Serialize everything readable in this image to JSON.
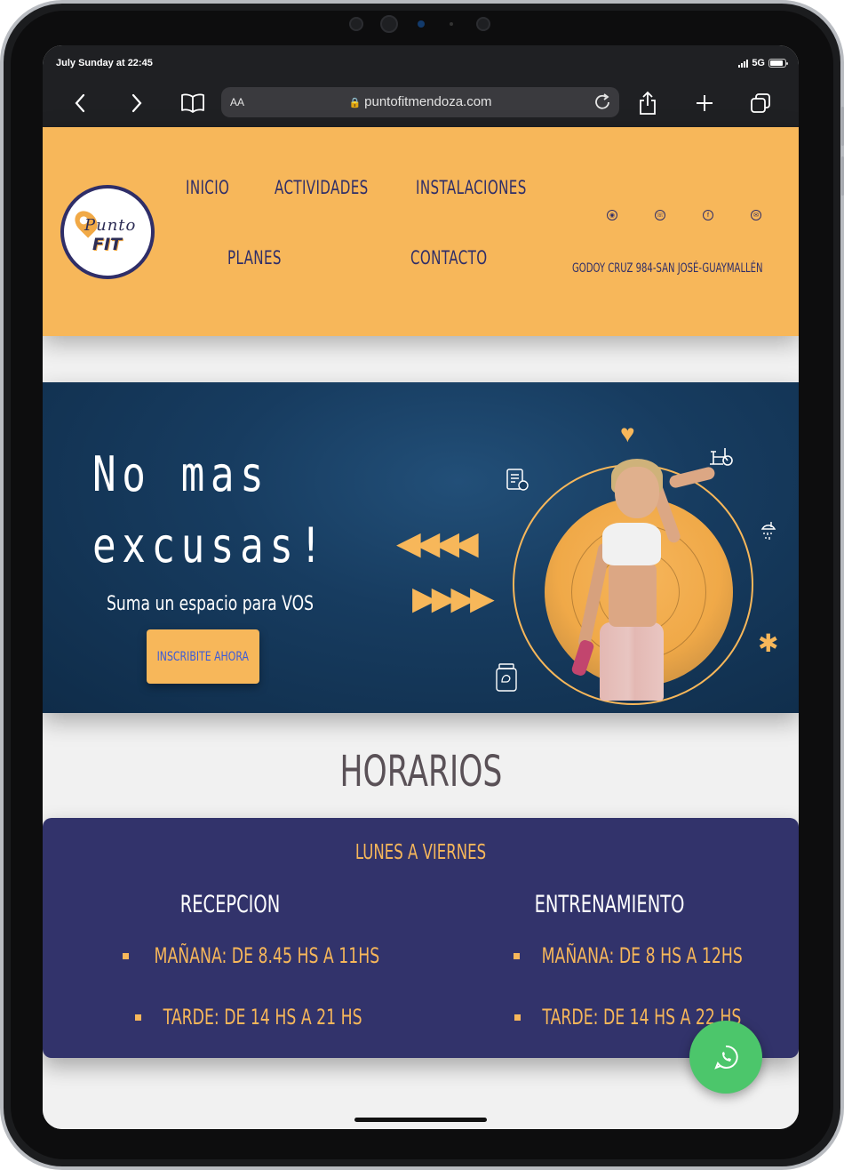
{
  "status_bar": {
    "time": "July Sunday at 22:45",
    "network": "5G"
  },
  "browser": {
    "reader_label": "AA",
    "url": "puntofitmendoza.com",
    "icons": [
      "chevron-left-icon",
      "chevron-right-icon",
      "book-icon",
      "lock-icon",
      "reload-icon",
      "share-icon",
      "plus-icon",
      "tabs-icon"
    ]
  },
  "header": {
    "logo": {
      "line1": "Punto",
      "line2": "FIT"
    },
    "nav": {
      "inicio": "INICIO",
      "actividades": "ACTIVIDADES",
      "instalaciones": "INSTALACIONES",
      "planes": "PLANES",
      "contacto": "CONTACTO"
    },
    "social_icons": [
      "instagram-icon",
      "whatsapp-icon",
      "facebook-icon",
      "email-icon"
    ],
    "address": "GODOY CRUZ 984-SAN JOSÉ-GUAYMALLÉN"
  },
  "hero": {
    "title_line1": "No mas",
    "title_line2": "excusas!",
    "subtitle": "Suma un espacio para VOS",
    "cta": "INSCRIBITE AHORA",
    "icons": [
      "heart-icon",
      "bike-icon",
      "clipboard-icon",
      "shower-icon",
      "asterisk-icon",
      "supplement-jar-icon",
      "arrows-left-icon",
      "arrows-right-icon"
    ]
  },
  "horarios": {
    "title": "HORARIOS",
    "days": "LUNES A VIERNES",
    "recepcion": {
      "title": "RECEPCION",
      "manana": "MAÑANA: DE 8.45 HS A 11HS",
      "tarde": "TARDE: DE 14 HS A 21 HS"
    },
    "entrenamiento": {
      "title": "ENTRENAMIENTO",
      "manana": "MAÑANA: DE 8 HS A 12HS",
      "tarde": "TARDE: DE 14 HS A 22 HS"
    }
  },
  "colors": {
    "accent": "#f7b75a",
    "navy": "#32336b",
    "hero_bg": "#173c60",
    "whatsapp": "#4cc66b"
  }
}
